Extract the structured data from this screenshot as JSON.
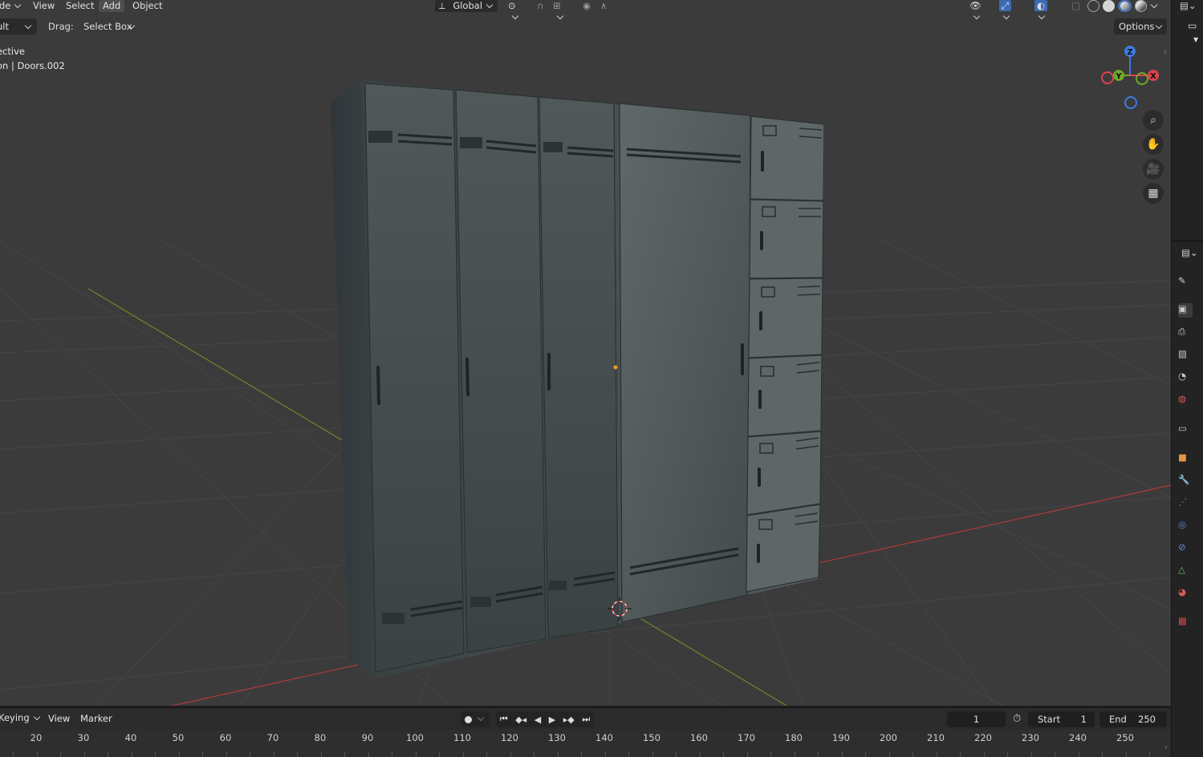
{
  "header": {
    "mode_fragment": "de",
    "menus": [
      "View",
      "Select",
      "Add",
      "Object"
    ],
    "active_menu": "Add",
    "transform_orientation": "Global"
  },
  "toolbar": {
    "orientation_fragment": "ult",
    "drag_label": "Drag:",
    "drag_value": "Select Box",
    "options_label": "Options"
  },
  "overlay": {
    "line1": "ective",
    "line2": "on | Doors.002"
  },
  "gizmo": {
    "z": "Z",
    "y": "Y",
    "x": "X"
  },
  "nav_icons": [
    "zoom-icon",
    "pan-hand-icon",
    "camera-icon",
    "ortho-grid-icon"
  ],
  "properties_icons": [
    "tool-icon",
    "render-icon",
    "output-icon",
    "view-layer-icon",
    "scene-icon",
    "world-icon",
    "collection-icon",
    "object-icon",
    "modifier-icon",
    "particles-icon",
    "physics-icon",
    "constraints-icon",
    "data-icon",
    "material-icon",
    "texture-icon"
  ],
  "timeline": {
    "keying_label": "Keying",
    "view_label": "View",
    "marker_label": "Marker",
    "current_frame": "1",
    "start_label": "Start",
    "start_value": "1",
    "end_label": "End",
    "end_value": "250",
    "ruler": [
      "20",
      "30",
      "40",
      "50",
      "60",
      "70",
      "80",
      "90",
      "100",
      "110",
      "120",
      "130",
      "140",
      "150",
      "160",
      "170",
      "180",
      "190",
      "200",
      "210",
      "220",
      "230",
      "240",
      "250"
    ]
  },
  "colors": {
    "viewport_bg": "#3b3b3b",
    "x_axis": "#b33a3a",
    "y_axis": "#6b8a2a",
    "gizmo_z": "#3b7de0",
    "gizmo_y": "#6fa82a",
    "gizmo_x": "#e0404f",
    "locker": "#3f4547"
  }
}
